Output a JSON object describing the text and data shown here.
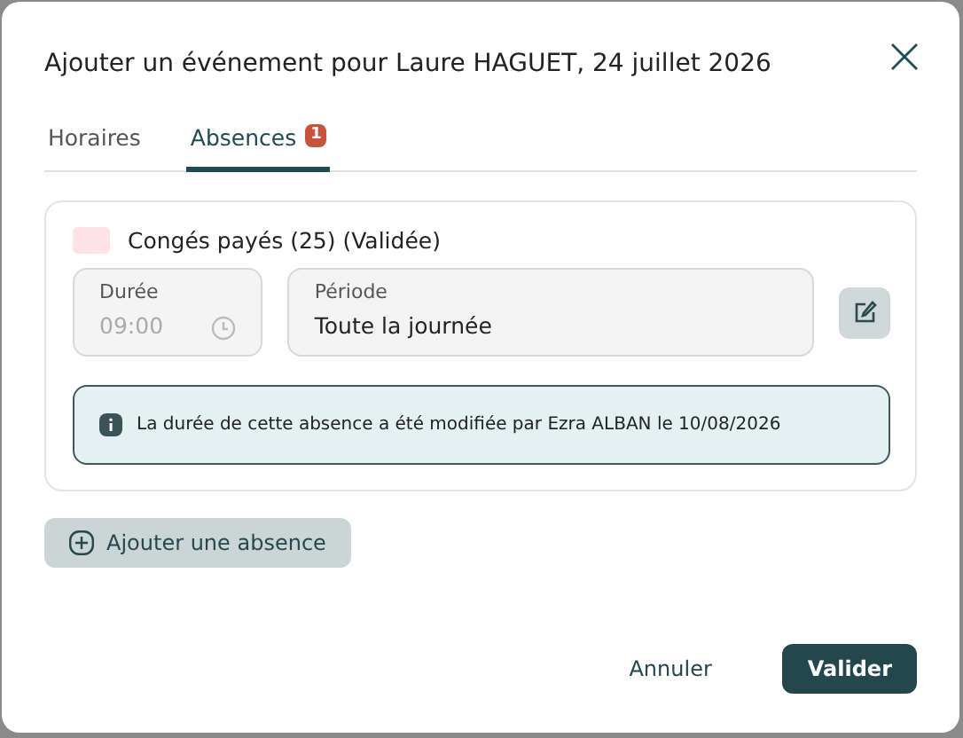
{
  "dialog": {
    "title": "Ajouter un événement pour Laure HAGUET, 24 juillet 2026"
  },
  "tabs": [
    {
      "label": "Horaires",
      "selected": false
    },
    {
      "label": "Absences",
      "selected": true,
      "badge": "1"
    }
  ],
  "absences": [
    {
      "type": "Congés payés (25) (Validée)",
      "color": "#fde1e6",
      "duration": {
        "label": "Durée",
        "value": "09:00",
        "disabled": true
      },
      "period": {
        "label": "Période",
        "value": "Toute la journée"
      },
      "notice": "La durée de cette absence a été modifiée par Ezra ALBAN le 10/08/2026"
    }
  ],
  "add_button": "Ajouter une absence",
  "buttons": [
    {
      "label": "Annuler",
      "kind": "secondary"
    },
    {
      "label": "Valider",
      "kind": "primary"
    }
  ]
}
